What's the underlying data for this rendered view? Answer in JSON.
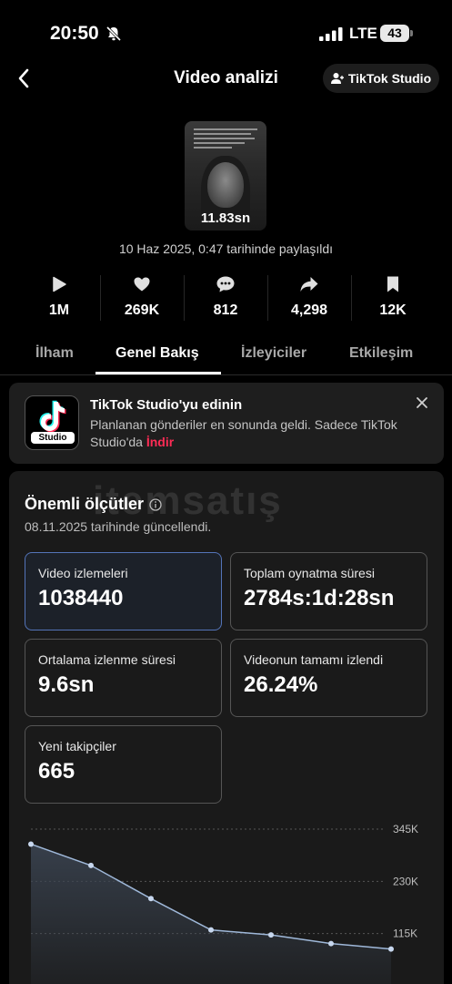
{
  "status_bar": {
    "time": "20:50",
    "network": "LTE",
    "battery": "43"
  },
  "header": {
    "title": "Video analizi",
    "studio_button": "TikTok Studio"
  },
  "video": {
    "duration": "11.83sn",
    "posted": "10 Haz 2025, 0:47 tarihinde paylaşıldı"
  },
  "stats": [
    {
      "icon": "play-icon",
      "value": "1M"
    },
    {
      "icon": "heart-icon",
      "value": "269K"
    },
    {
      "icon": "comment-icon",
      "value": "812"
    },
    {
      "icon": "share-icon",
      "value": "4,298"
    },
    {
      "icon": "bookmark-icon",
      "value": "12K"
    }
  ],
  "tabs": [
    "İlham",
    "Genel Bakış",
    "İzleyiciler",
    "Etkileşim"
  ],
  "active_tab": "Genel Bakış",
  "promo": {
    "title": "TikTok Studio'yu edinin",
    "description": "Planlanan gönderiler en sonunda geldi. Sadece TikTok Studio'da",
    "link": "İndir",
    "logo_tag": "Studio"
  },
  "metrics": {
    "title": "Önemli ölçütler",
    "updated": "08.11.2025 tarihinde güncellendi.",
    "items": [
      {
        "label": "Video izlemeleri",
        "value": "1038440"
      },
      {
        "label": "Toplam oynatma süresi",
        "value": "2784s:1d:28sn"
      },
      {
        "label": "Ortalama izlenme süresi",
        "value": "9.6sn"
      },
      {
        "label": "Videonun tamamı izlendi",
        "value": "26.24%"
      },
      {
        "label": "Yeni takipçiler",
        "value": "665"
      }
    ]
  },
  "watermark": "itemsatış",
  "chart_data": {
    "type": "area",
    "y_ticks": [
      "345K",
      "230K",
      "115K"
    ],
    "ylim": [
      0,
      345000
    ],
    "values": [
      312000,
      265000,
      192000,
      123000,
      112000,
      93000,
      81000
    ],
    "colors": {
      "line": "#9fb8d9",
      "fill": "#3a4350"
    }
  },
  "colors": {
    "accent": "#fe2c55",
    "selected_border": "#5474b8"
  }
}
